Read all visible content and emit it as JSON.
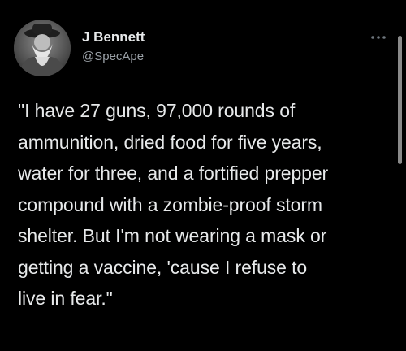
{
  "author": {
    "display_name": "J Bennett",
    "handle": "@SpecApe",
    "avatar_icon": "bearded-man-avatar"
  },
  "more_menu": {
    "icon": "more-horizontal-icon"
  },
  "tweet": {
    "lines": [
      "\"I have 27 guns, 97,000 rounds of",
      "ammunition, dried food for five years,",
      "water for three, and a fortified prepper",
      "compound with a zombie-proof storm",
      "shelter. But I'm not wearing a mask or",
      "getting a vaccine, 'cause I refuse to",
      "live in fear.\""
    ]
  },
  "colors": {
    "background": "#000000",
    "primary_text": "#e7e9ea",
    "secondary_text": "#9aa0a6"
  }
}
